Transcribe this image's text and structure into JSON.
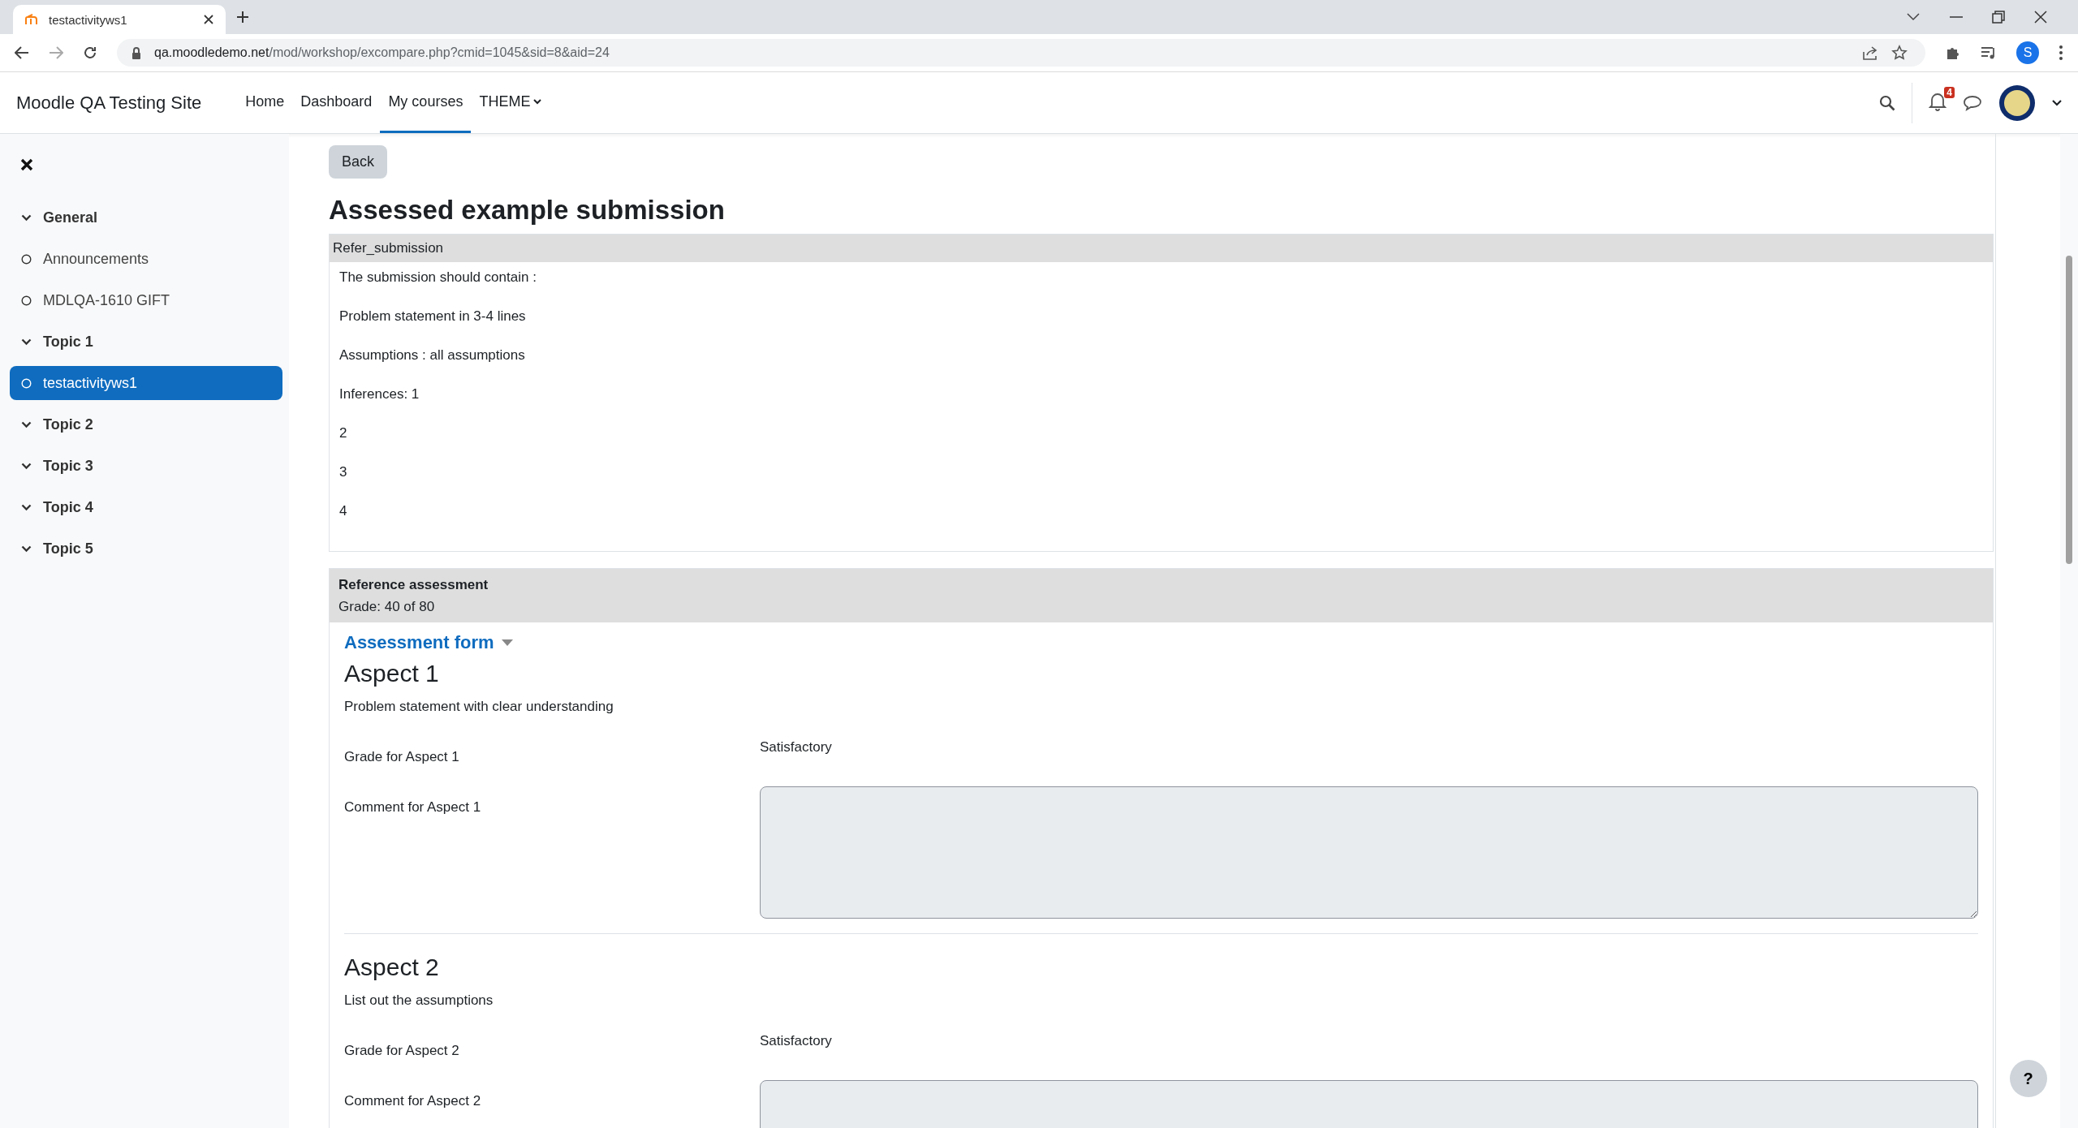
{
  "browser": {
    "tab_title": "testactivityws1",
    "url_host": "qa.moodledemo.net",
    "url_path": "/mod/workshop/excompare.php?cmid=1045&sid=8&aid=24",
    "profile_initial": "S"
  },
  "navbar": {
    "site_name": "Moodle QA Testing Site",
    "items": [
      {
        "label": "Home",
        "selected": false,
        "kind": "link"
      },
      {
        "label": "Dashboard",
        "selected": false,
        "kind": "link"
      },
      {
        "label": "My courses",
        "selected": true,
        "kind": "link"
      },
      {
        "label": "THEME",
        "selected": false,
        "kind": "dropdown"
      }
    ],
    "notification_count": "4"
  },
  "sidebar": {
    "items": [
      {
        "label": "General",
        "kind": "section",
        "selected": false
      },
      {
        "label": "Announcements",
        "kind": "activity",
        "selected": false
      },
      {
        "label": "MDLQA-1610 GIFT",
        "kind": "activity",
        "selected": false
      },
      {
        "label": "Topic 1",
        "kind": "section",
        "selected": false
      },
      {
        "label": "testactivityws1",
        "kind": "activity",
        "selected": true
      },
      {
        "label": "Topic 2",
        "kind": "section",
        "selected": false
      },
      {
        "label": "Topic 3",
        "kind": "section",
        "selected": false
      },
      {
        "label": "Topic 4",
        "kind": "section",
        "selected": false
      },
      {
        "label": "Topic 5",
        "kind": "section",
        "selected": false
      }
    ]
  },
  "content": {
    "back_button": "Back",
    "heading": "Assessed example submission",
    "submission": {
      "title": "Refer_submission",
      "lines": [
        "The submission should contain :",
        "Problem statement in 3-4 lines",
        "Assumptions : all assumptions",
        "Inferences: 1",
        "2",
        "3",
        "4"
      ]
    },
    "reference": {
      "title": "Reference assessment",
      "grade": "Grade: 40 of 80"
    },
    "form": {
      "title": "Assessment form",
      "aspects": [
        {
          "title": "Aspect 1",
          "description": "Problem statement with clear understanding",
          "grade_label": "Grade for Aspect 1",
          "grade_value": "Satisfactory",
          "comment_label": "Comment for Aspect 1"
        },
        {
          "title": "Aspect 2",
          "description": "List out the assumptions",
          "grade_label": "Grade for Aspect 2",
          "grade_value": "Satisfactory",
          "comment_label": "Comment for Aspect 2"
        }
      ]
    }
  },
  "help_button": "?"
}
